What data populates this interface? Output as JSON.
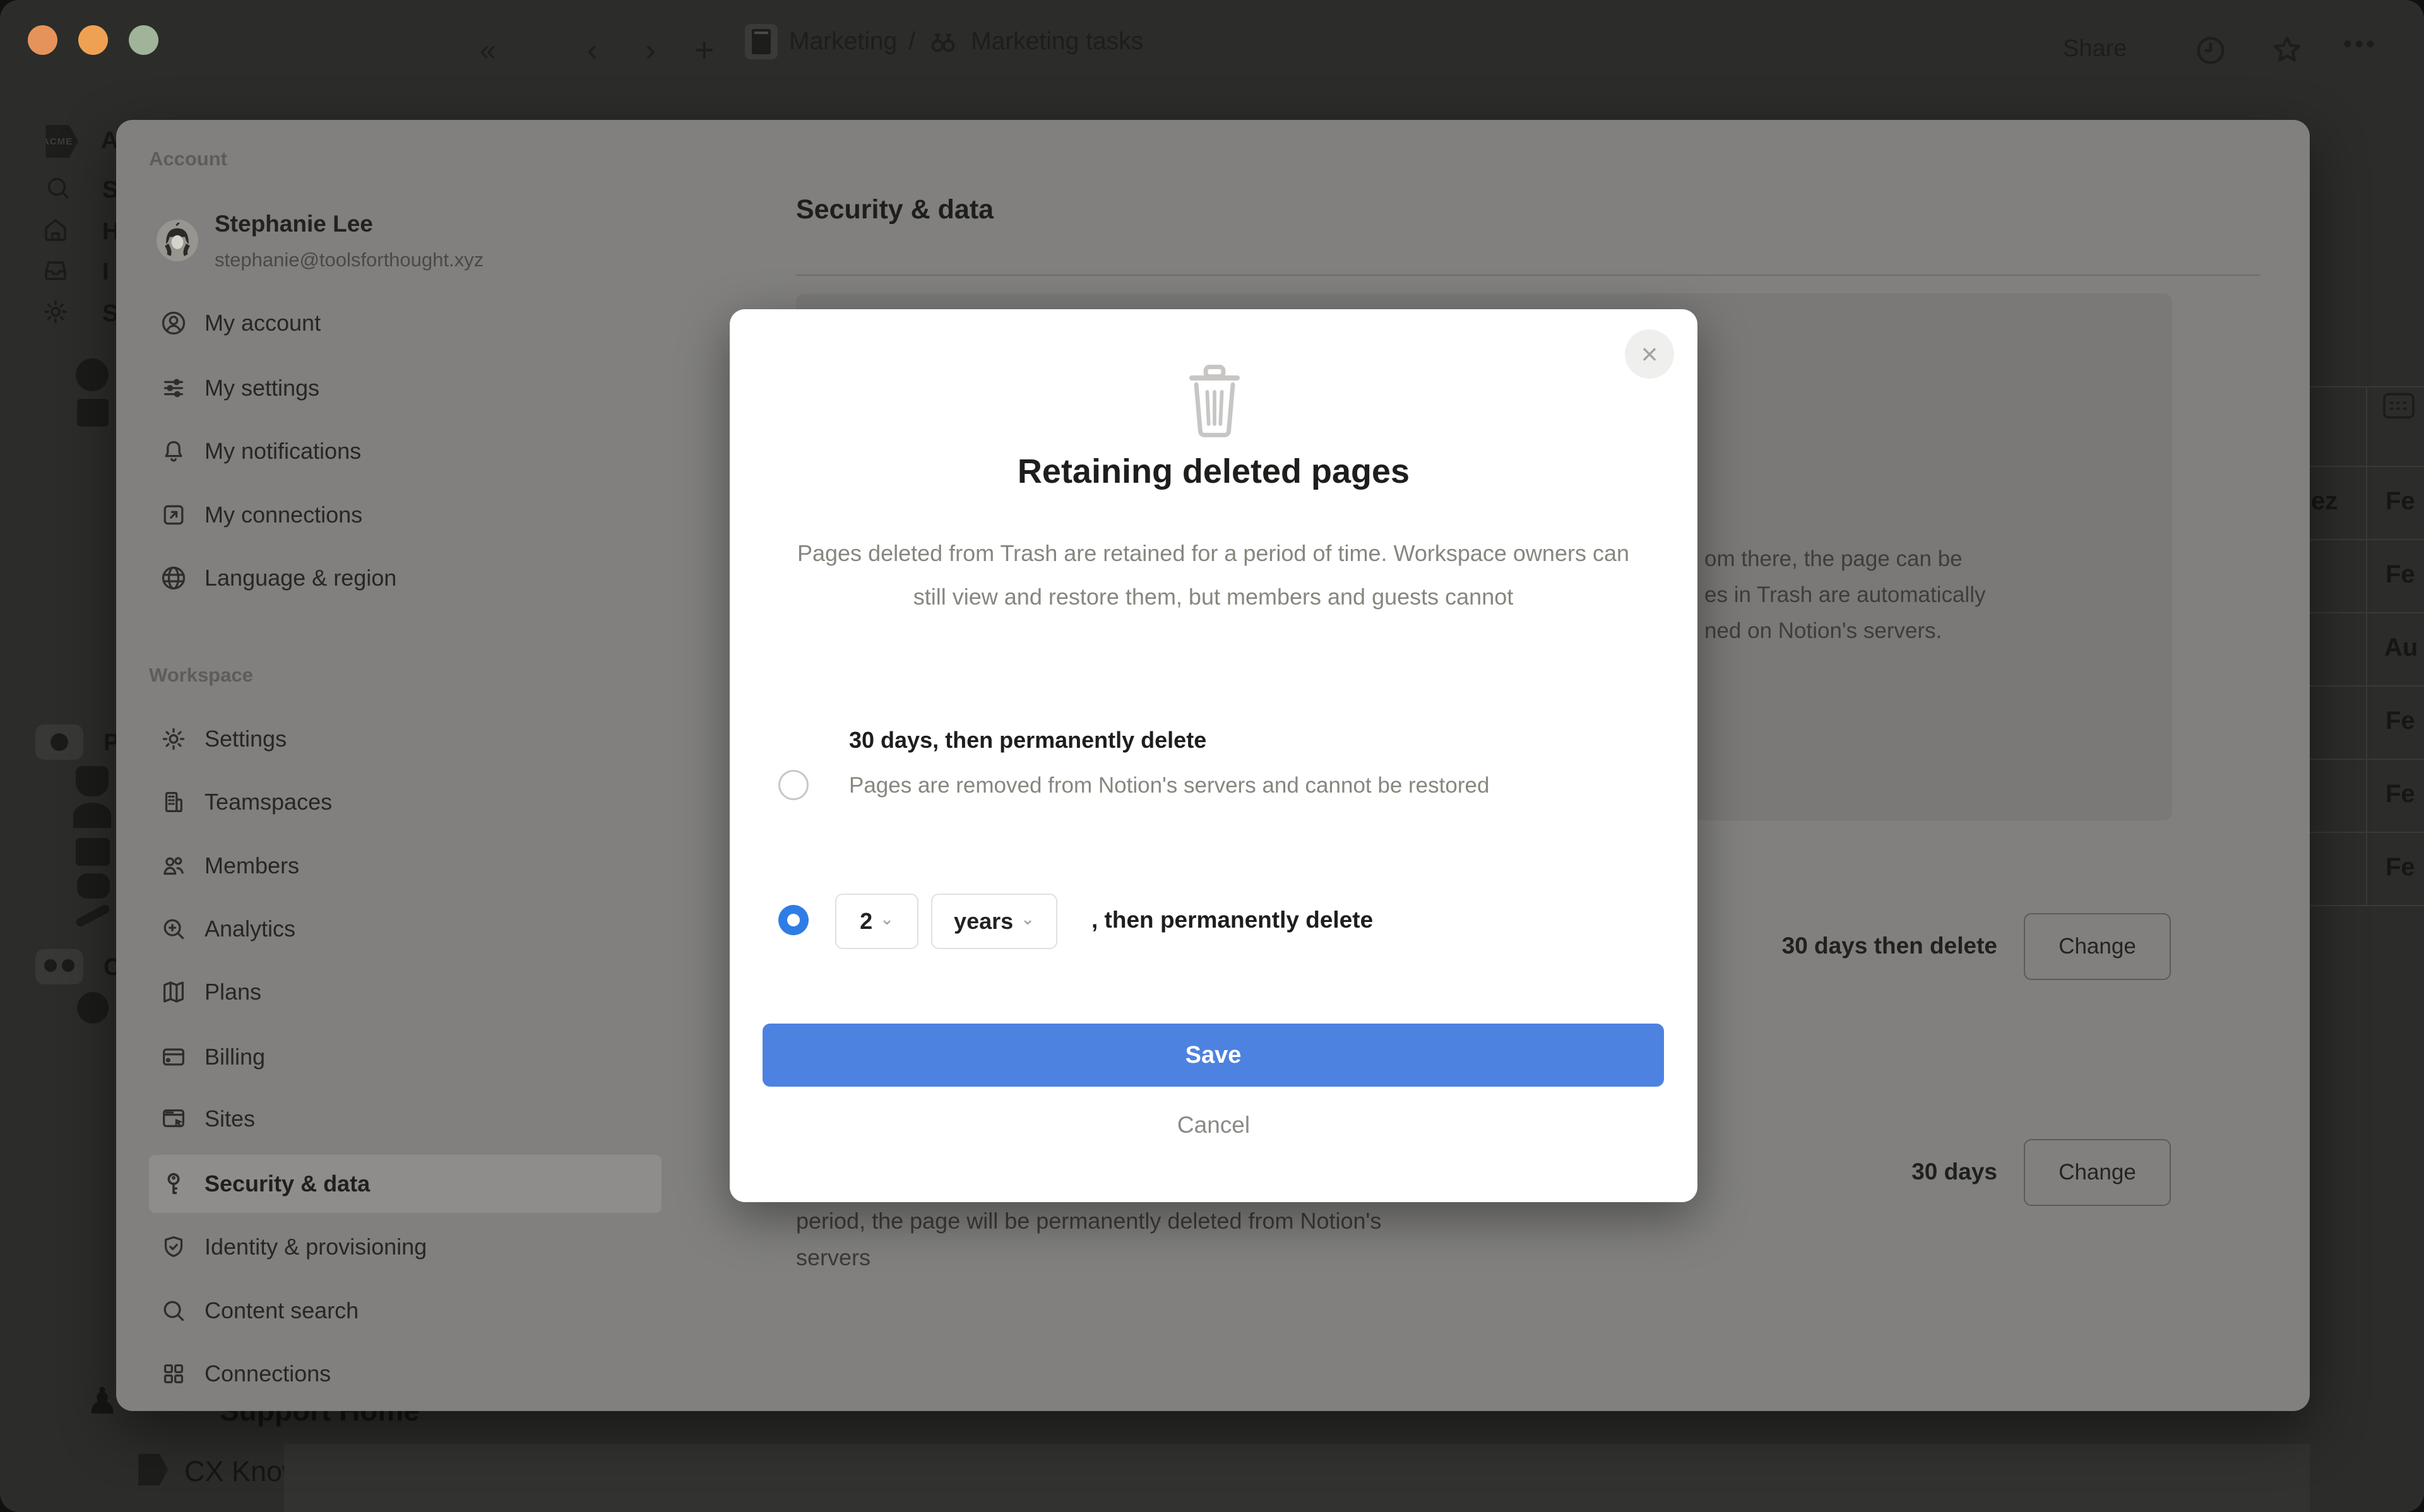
{
  "colors": {
    "save_bg": "#4d82e0",
    "radio_selected": "#2e7de6",
    "traffic_red": "#e5935a",
    "traffic_yellow": "#efa153",
    "traffic_green": "#9fb499"
  },
  "topbar": {
    "collapse": "«",
    "back": "‹",
    "forward": "›",
    "new_page": "+",
    "breadcrumb": {
      "first": "Marketing",
      "divider": "/",
      "second": "Marketing tasks"
    },
    "share": "Share",
    "more": "•••"
  },
  "rail": {
    "logo": "ACME",
    "workspace_initial": "A",
    "nav_fragments": [
      "S",
      "H",
      "I",
      "S"
    ],
    "page_fragments": [
      "P",
      "C"
    ],
    "pawn": "♟",
    "support_home": "Support Home",
    "knowledge_base": "CX Knowledge Base"
  },
  "table": {
    "name_fragment": "ez",
    "dates": [
      "Fe",
      "Fe",
      "Au",
      "Fe",
      "Fe",
      "Fe"
    ]
  },
  "settings": {
    "account_label": "Account",
    "user": {
      "name": "Stephanie Lee",
      "email": "stephanie@toolsforthought.xyz"
    },
    "account_items": [
      {
        "label": "My account"
      },
      {
        "label": "My settings"
      },
      {
        "label": "My notifications"
      },
      {
        "label": "My connections"
      },
      {
        "label": "Language & region"
      }
    ],
    "workspace_label": "Workspace",
    "workspace_items": [
      {
        "label": "Settings"
      },
      {
        "label": "Teamspaces"
      },
      {
        "label": "Members"
      },
      {
        "label": "Analytics"
      },
      {
        "label": "Plans"
      },
      {
        "label": "Billing"
      },
      {
        "label": "Sites"
      },
      {
        "label": "Security & data"
      },
      {
        "label": "Identity & provisioning"
      },
      {
        "label": "Content search"
      },
      {
        "label": "Connections"
      }
    ]
  },
  "content": {
    "heading": "Security & data",
    "box_lines": [
      "om there, the page can be",
      "es in Trash are automatically",
      "ned on Notion's servers."
    ],
    "retention_value": "30 days then delete",
    "retention_button": "Change",
    "trash_value": "30 days",
    "trash_button": "Change",
    "below_line1": "period, the page will be permanently deleted from Notion's",
    "below_line2": "servers"
  },
  "modal": {
    "close": "×",
    "title": "Retaining deleted pages",
    "description": "Pages deleted from Trash are retained for a period of time. Workspace owners can still view and restore them, but members and guests cannot",
    "option1": {
      "selected": false,
      "label": "30 days, then permanently delete",
      "sub": "Pages are removed from Notion's servers and cannot be restored"
    },
    "option2": {
      "selected": true,
      "number": "2",
      "number_chevron": "⌄",
      "unit": "years",
      "unit_chevron": "⌄",
      "suffix": ", then permanently delete"
    },
    "save": "Save",
    "cancel": "Cancel"
  }
}
